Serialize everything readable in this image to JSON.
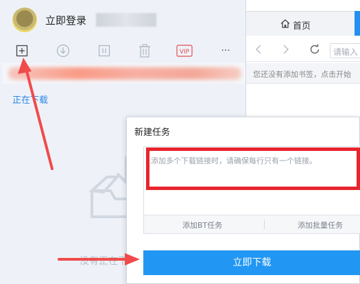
{
  "user": {
    "login_label": "立即登录"
  },
  "toolbar": {
    "icons": [
      "new-task-icon",
      "download-icon",
      "pause-icon",
      "delete-icon",
      "vip-icon",
      "more-icon"
    ],
    "vip_label": "VIP",
    "more_label": "···"
  },
  "download_list": {
    "status_label": "正在下载",
    "empty_text": "没有正在下载"
  },
  "browser": {
    "tab_home_label": "首页",
    "url_placeholder": "请输入",
    "bookmark_hint": "您还没有添加书签，点击开始"
  },
  "dialog": {
    "title": "新建任务",
    "input_placeholder": "添加多个下载链接时，请确保每行只有一个链接。",
    "add_bt_label": "添加BT任务",
    "add_batch_label": "添加批量任务",
    "download_button_label": "立即下载"
  },
  "colors": {
    "accent": "#2196f3",
    "annotation": "#e8242e",
    "link": "#2b86e4"
  }
}
